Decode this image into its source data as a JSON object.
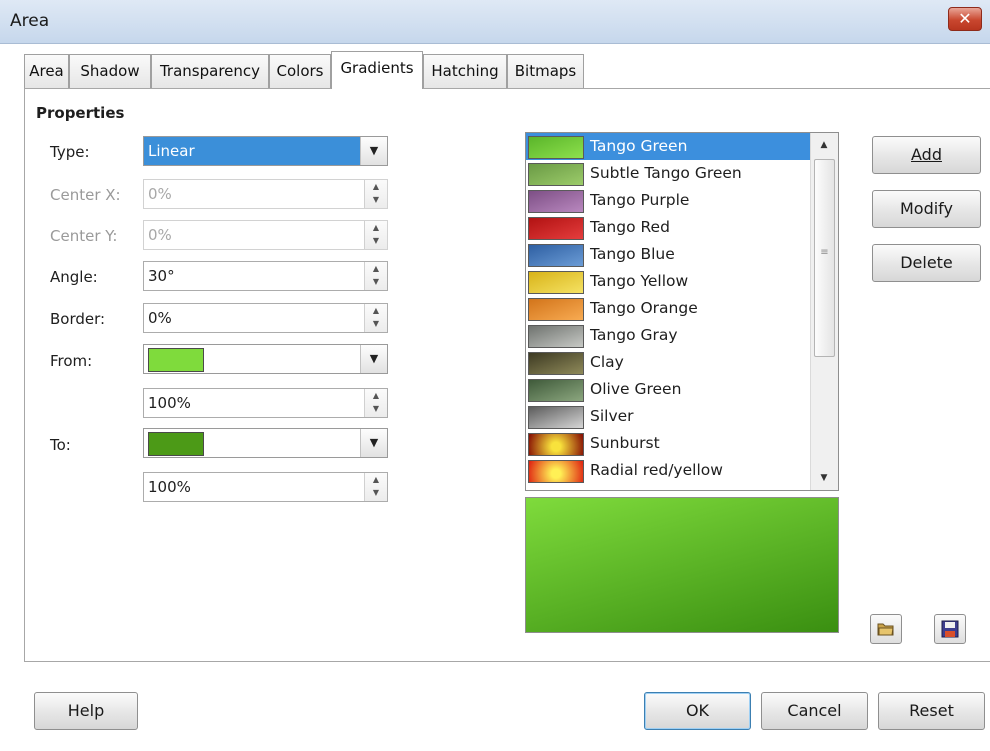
{
  "window": {
    "title": "Area",
    "close_glyph": "✕"
  },
  "tabs": [
    {
      "label": "Area"
    },
    {
      "label": "Shadow"
    },
    {
      "label": "Transparency"
    },
    {
      "label": "Colors"
    },
    {
      "label": "Gradients",
      "active": true
    },
    {
      "label": "Hatching"
    },
    {
      "label": "Bitmaps"
    }
  ],
  "properties": {
    "heading": "Properties",
    "type": {
      "label": "Type:",
      "value": "Linear"
    },
    "center_x": {
      "label": "Center X:",
      "value": "0%",
      "enabled": false
    },
    "center_y": {
      "label": "Center Y:",
      "value": "0%",
      "enabled": false
    },
    "angle": {
      "label": "Angle:",
      "value": "30°"
    },
    "border": {
      "label": "Border:",
      "value": "0%"
    },
    "from": {
      "label": "From:",
      "color": "#7fdb3c",
      "intensity": "100%"
    },
    "to": {
      "label": "To:",
      "color": "#4c9a17",
      "intensity": "100%"
    }
  },
  "gradient_list": {
    "selected_index": 0,
    "items": [
      {
        "name": "Tango Green",
        "colors": [
          "#5ab52a",
          "#8ee04d"
        ]
      },
      {
        "name": "Subtle Tango Green",
        "colors": [
          "#6a9a45",
          "#9ccc6a"
        ]
      },
      {
        "name": "Tango Purple",
        "colors": [
          "#7d4f85",
          "#b988bf"
        ]
      },
      {
        "name": "Tango Red",
        "colors": [
          "#b11212",
          "#e53d3d"
        ]
      },
      {
        "name": "Tango Blue",
        "colors": [
          "#2e5fa2",
          "#6b9cd6"
        ]
      },
      {
        "name": "Tango Yellow",
        "colors": [
          "#d8b319",
          "#f5e263"
        ]
      },
      {
        "name": "Tango Orange",
        "colors": [
          "#d2741a",
          "#f8ab52"
        ]
      },
      {
        "name": "Tango Gray",
        "colors": [
          "#6f736f",
          "#c7c9c5"
        ]
      },
      {
        "name": "Clay",
        "colors": [
          "#3d3a22",
          "#8f8a5a"
        ]
      },
      {
        "name": "Olive Green",
        "colors": [
          "#3f5a3a",
          "#8ca77f"
        ]
      },
      {
        "name": "Silver",
        "colors": [
          "#5c5c5c",
          "#d6d6d6"
        ]
      },
      {
        "name": "Sunburst",
        "colors": [
          "#f8e23c",
          "#8a1505"
        ]
      },
      {
        "name": "Radial red/yellow",
        "colors": [
          "#fff055",
          "#e02a14"
        ]
      }
    ]
  },
  "preview": {
    "from": "#7fdb3c",
    "to": "#3a8f11"
  },
  "side_buttons": {
    "add": "Add",
    "modify": "Modify",
    "delete": "Delete"
  },
  "icons": {
    "load": "folder-open-icon",
    "save": "save-icon"
  },
  "bottom_buttons": {
    "help": "Help",
    "ok": "OK",
    "cancel": "Cancel",
    "reset": "Reset"
  }
}
